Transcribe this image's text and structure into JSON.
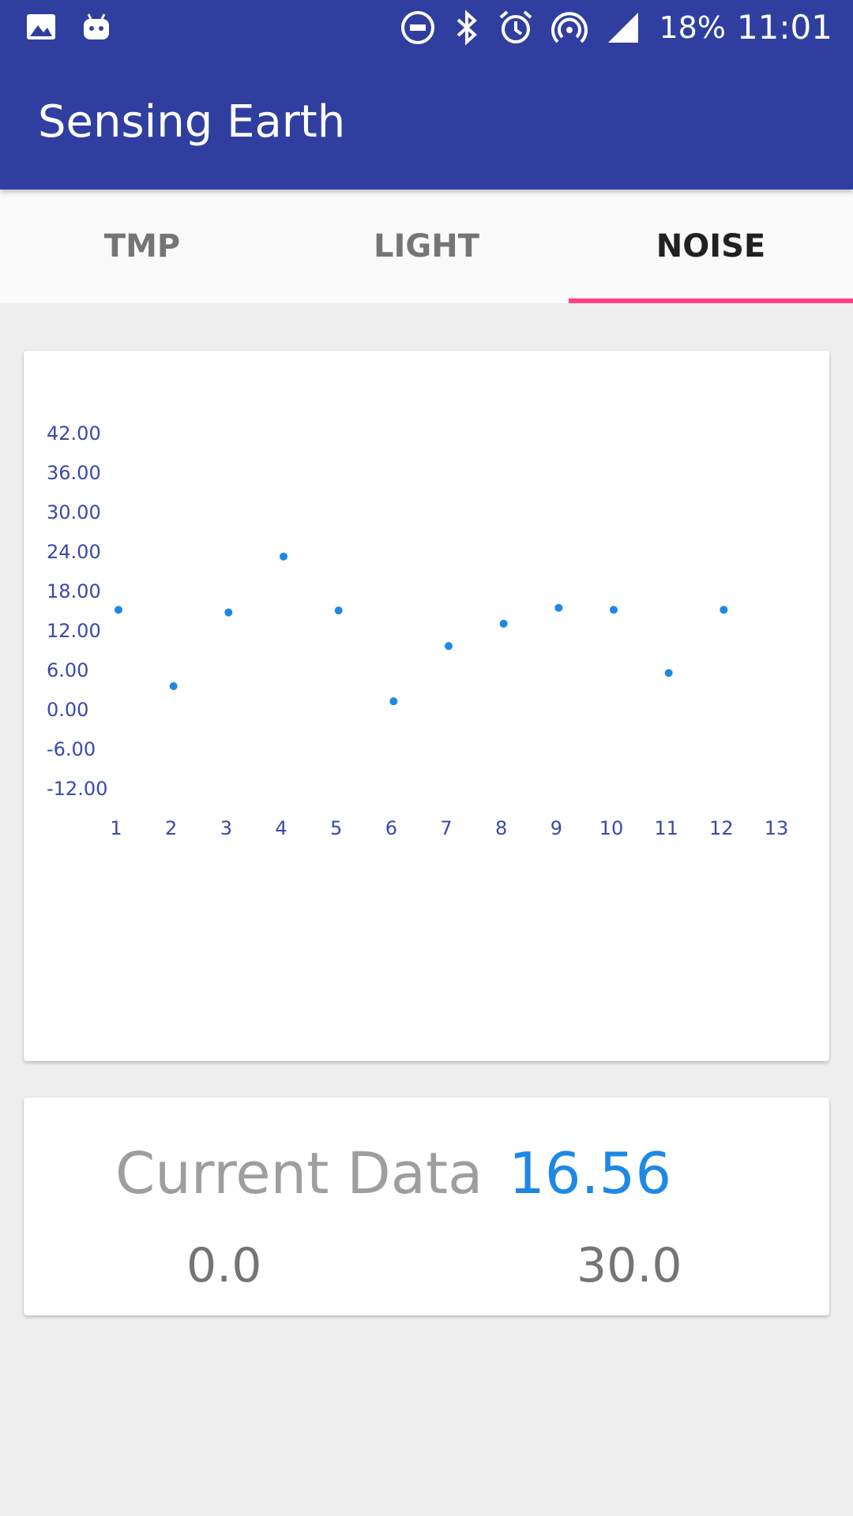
{
  "status_bar": {
    "left_icons": [
      "image-icon",
      "android-icon"
    ],
    "right_icons": [
      "do-not-disturb-icon",
      "bluetooth-icon",
      "alarm-icon",
      "hotspot-icon",
      "signal-icon"
    ],
    "battery": "18%",
    "time": "11:01"
  },
  "app_bar": {
    "title": "Sensing Earth"
  },
  "tabs": [
    {
      "label": "TMP",
      "active": false
    },
    {
      "label": "LIGHT",
      "active": false
    },
    {
      "label": "NOISE",
      "active": true
    }
  ],
  "colors": {
    "primary": "#303f9f",
    "accent": "#ff4081",
    "point": "#1e88e5",
    "axis_text": "#3949ab"
  },
  "chart_data": {
    "type": "scatter",
    "x": [
      1,
      2,
      3,
      4,
      5,
      6,
      7,
      8,
      9,
      10,
      11,
      12
    ],
    "values": [
      15.2,
      3.6,
      14.8,
      23.3,
      15.1,
      1.3,
      9.7,
      13.1,
      15.5,
      15.2,
      5.6,
      15.2
    ],
    "x_ticks": [
      "1",
      "2",
      "3",
      "4",
      "5",
      "6",
      "7",
      "8",
      "9",
      "10",
      "11",
      "12",
      "13"
    ],
    "y_ticks": [
      "42.00",
      "36.00",
      "30.00",
      "24.00",
      "18.00",
      "12.00",
      "6.00",
      "0.00",
      "-6.00",
      "-12.00"
    ],
    "ylim": [
      -12,
      42
    ],
    "xlim": [
      1,
      13
    ],
    "grid": false
  },
  "summary": {
    "current_label": "Current Data",
    "current_value": "16.56",
    "min": "0.0",
    "max": "30.0"
  }
}
